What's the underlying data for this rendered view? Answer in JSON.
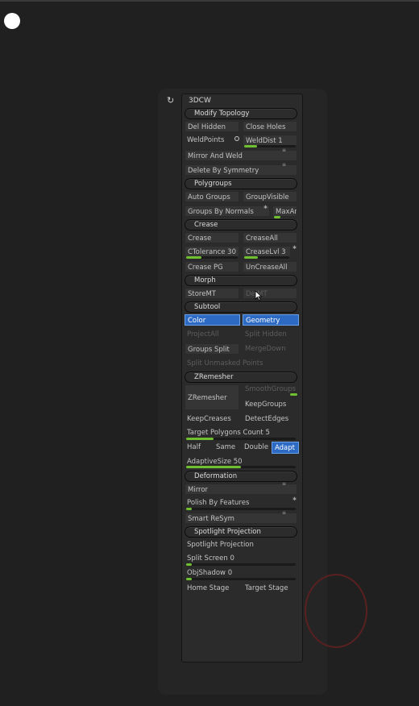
{
  "panel": {
    "title": "3DCW"
  },
  "modify_topology": {
    "header": "Modify Topology",
    "del_hidden": "Del Hidden",
    "close_holes": "Close Holes",
    "weld_points": "WeldPoints",
    "weld_dist": "WeldDist 1",
    "mirror_and_weld": "Mirror And Weld",
    "delete_by_symmetry": "Delete By Symmetry"
  },
  "polygroups": {
    "header": "Polygroups",
    "auto_groups": "Auto Groups",
    "group_visible": "GroupVisible",
    "groups_by_normals": "Groups By Normals",
    "max_angle": "MaxAng"
  },
  "crease": {
    "header": "Crease",
    "crease": "Crease",
    "crease_all": "CreaseAll",
    "ctolerance": "CTolerance 30",
    "crease_lvl": "CreaseLvl 3",
    "crease_pg": "Crease PG",
    "uncrease_all": "UnCreaseAll"
  },
  "morph": {
    "header": "Morph",
    "store_mt": "StoreMT",
    "del_mt": "DelMT"
  },
  "subtool": {
    "header": "Subtool",
    "color": "Color",
    "geometry": "Geometry",
    "project_all": "ProjectAll",
    "split_hidden": "Split Hidden",
    "groups_split": "Groups Split",
    "merge_down": "MergeDown",
    "split_unmasked": "Split Unmasked Points"
  },
  "zremesher": {
    "header": "ZRemesher",
    "zremesher": "ZRemesher",
    "smooth_groups": "SmoothGroups",
    "keep_groups": "KeepGroups",
    "keep_creases": "KeepCreases",
    "detect_edges": "DetectEdges",
    "target_polygons": "Target Polygons Count 5",
    "half": "Half",
    "same": "Same",
    "double": "Double",
    "adapt": "Adapt",
    "adaptive_size": "AdaptiveSize 50"
  },
  "deformation": {
    "header": "Deformation",
    "mirror": "Mirror",
    "polish_by_features": "Polish By Features",
    "smart_resym": "Smart ReSym"
  },
  "spotlight": {
    "header": "Spotlight Projection",
    "spotlight_projection": "Spotlight Projection",
    "split_screen": "Split Screen 0",
    "obj_shadow": "ObjShadow 0",
    "home_stage": "Home Stage",
    "target_stage": "Target Stage"
  },
  "sliders": {
    "weld_dist": 0.25,
    "ctolerance": 0.3,
    "crease_lvl": 0.3,
    "target_polygons": 0.25,
    "adaptive_size": 0.5,
    "polish_by_features": 0.05,
    "split_screen": 0.05,
    "obj_shadow": 0.05
  },
  "colors": {
    "accent": "#2c6ac4",
    "slider": "#6fbf30",
    "panel": "#2b2b2b"
  }
}
